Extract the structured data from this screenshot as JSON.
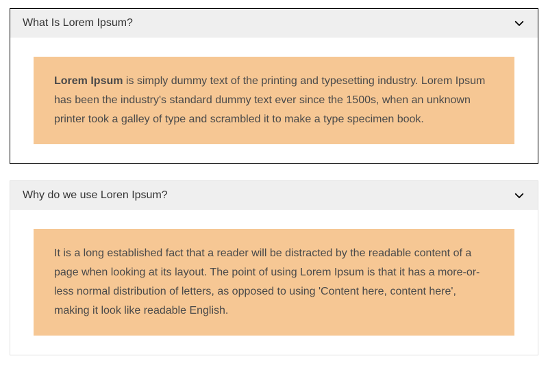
{
  "colors": {
    "panel_bg": "#f6c794",
    "header_bg": "#efefef",
    "text": "#4a4a4a"
  },
  "accordion": {
    "items": [
      {
        "title": "What Is Lorem Ipsum?",
        "lead_bold": "Lorem Ipsum",
        "body_after": " is simply dummy text of the printing and typesetting industry. Lorem Ipsum has been the industry's standard dummy text ever since the 1500s, when an unknown printer took a galley of type and scrambled it to make a type specimen book.",
        "selected": true,
        "expanded": true
      },
      {
        "title": "Why do we use Loren Ipsum?",
        "body": "It is a long established fact that a reader will be distracted by the readable content of a page when looking at its layout. The point of using Lorem Ipsum is that it has a more-or-less normal distribution of letters, as opposed to using 'Content here, content here', making it look like readable English.",
        "selected": false,
        "expanded": true
      }
    ]
  }
}
